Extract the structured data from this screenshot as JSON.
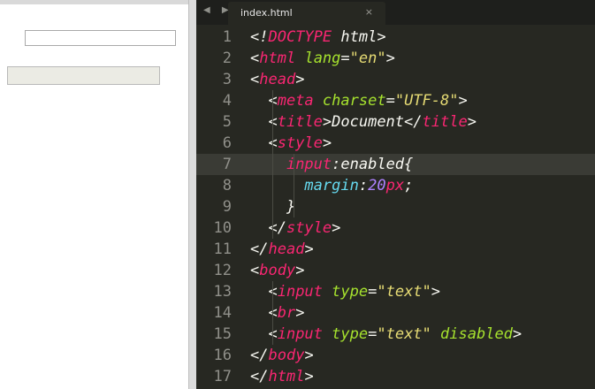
{
  "editor": {
    "tab_title": "index.html",
    "tab_close_glyph": "×",
    "nav_arrows": "◀ ▶",
    "active_line": 7,
    "lines": [
      {
        "num": "1",
        "tokens": [
          {
            "t": "<!",
            "c": "pl"
          },
          {
            "t": "DOCTYPE",
            "c": "kw"
          },
          {
            "t": " html>",
            "c": "pl"
          }
        ]
      },
      {
        "num": "2",
        "tokens": [
          {
            "t": "<",
            "c": "pl"
          },
          {
            "t": "html",
            "c": "kw"
          },
          {
            "t": " ",
            "c": "pl"
          },
          {
            "t": "lang",
            "c": "at"
          },
          {
            "t": "=",
            "c": "pl"
          },
          {
            "t": "\"en\"",
            "c": "str"
          },
          {
            "t": ">",
            "c": "pl"
          }
        ]
      },
      {
        "num": "3",
        "tokens": [
          {
            "t": "<",
            "c": "pl"
          },
          {
            "t": "head",
            "c": "kw"
          },
          {
            "t": ">",
            "c": "pl"
          }
        ]
      },
      {
        "num": "4",
        "tokens": [
          {
            "t": "  <",
            "c": "pl"
          },
          {
            "t": "meta",
            "c": "kw"
          },
          {
            "t": " ",
            "c": "pl"
          },
          {
            "t": "charset",
            "c": "at"
          },
          {
            "t": "=",
            "c": "pl"
          },
          {
            "t": "\"UTF-8\"",
            "c": "str"
          },
          {
            "t": ">",
            "c": "pl"
          }
        ]
      },
      {
        "num": "5",
        "tokens": [
          {
            "t": "  <",
            "c": "pl"
          },
          {
            "t": "title",
            "c": "kw"
          },
          {
            "t": ">Document</",
            "c": "pl"
          },
          {
            "t": "title",
            "c": "kw"
          },
          {
            "t": ">",
            "c": "pl"
          }
        ]
      },
      {
        "num": "6",
        "tokens": [
          {
            "t": "  <",
            "c": "pl"
          },
          {
            "t": "style",
            "c": "kw"
          },
          {
            "t": ">",
            "c": "pl"
          }
        ]
      },
      {
        "num": "7",
        "tokens": [
          {
            "t": "    ",
            "c": "pl"
          },
          {
            "t": "input",
            "c": "kw"
          },
          {
            "t": ":",
            "c": "pl"
          },
          {
            "t": "enabled",
            "c": "pl"
          },
          {
            "t": "{",
            "c": "pl"
          }
        ]
      },
      {
        "num": "8",
        "tokens": [
          {
            "t": "      ",
            "c": "pl"
          },
          {
            "t": "margin",
            "c": "prop"
          },
          {
            "t": ":",
            "c": "pl"
          },
          {
            "t": "20",
            "c": "num"
          },
          {
            "t": "px",
            "c": "kw"
          },
          {
            "t": ";",
            "c": "pl"
          }
        ]
      },
      {
        "num": "9",
        "tokens": [
          {
            "t": "    }",
            "c": "pl"
          }
        ]
      },
      {
        "num": "10",
        "tokens": [
          {
            "t": "  </",
            "c": "pl"
          },
          {
            "t": "style",
            "c": "kw"
          },
          {
            "t": ">",
            "c": "pl"
          }
        ]
      },
      {
        "num": "11",
        "tokens": [
          {
            "t": "</",
            "c": "pl"
          },
          {
            "t": "head",
            "c": "kw"
          },
          {
            "t": ">",
            "c": "pl"
          }
        ]
      },
      {
        "num": "12",
        "tokens": [
          {
            "t": "<",
            "c": "pl"
          },
          {
            "t": "body",
            "c": "kw"
          },
          {
            "t": ">",
            "c": "pl"
          }
        ]
      },
      {
        "num": "13",
        "tokens": [
          {
            "t": "  <",
            "c": "pl"
          },
          {
            "t": "input",
            "c": "kw"
          },
          {
            "t": " ",
            "c": "pl"
          },
          {
            "t": "type",
            "c": "at"
          },
          {
            "t": "=",
            "c": "pl"
          },
          {
            "t": "\"text\"",
            "c": "str"
          },
          {
            "t": ">",
            "c": "pl"
          }
        ]
      },
      {
        "num": "14",
        "tokens": [
          {
            "t": "  <",
            "c": "pl"
          },
          {
            "t": "br",
            "c": "kw"
          },
          {
            "t": ">",
            "c": "pl"
          }
        ]
      },
      {
        "num": "15",
        "tokens": [
          {
            "t": "  <",
            "c": "pl"
          },
          {
            "t": "input",
            "c": "kw"
          },
          {
            "t": " ",
            "c": "pl"
          },
          {
            "t": "type",
            "c": "at"
          },
          {
            "t": "=",
            "c": "pl"
          },
          {
            "t": "\"text\"",
            "c": "str"
          },
          {
            "t": " ",
            "c": "pl"
          },
          {
            "t": "disabled",
            "c": "at"
          },
          {
            "t": ">",
            "c": "pl"
          }
        ]
      },
      {
        "num": "16",
        "tokens": [
          {
            "t": "</",
            "c": "pl"
          },
          {
            "t": "body",
            "c": "kw"
          },
          {
            "t": ">",
            "c": "pl"
          }
        ]
      },
      {
        "num": "17",
        "tokens": [
          {
            "t": "</",
            "c": "pl"
          },
          {
            "t": "html",
            "c": "kw"
          },
          {
            "t": ">",
            "c": "pl"
          }
        ]
      }
    ]
  },
  "colors": {
    "editor_bg": "#272822",
    "keyword": "#f92672",
    "attribute": "#a6e22e",
    "string": "#e6db74",
    "number": "#ae81ff",
    "property": "#66d9ef",
    "plain": "#f8f8f2",
    "gutter": "#90908a"
  },
  "icons": {
    "nav": "navigation-arrows-icon",
    "close": "close-icon"
  }
}
